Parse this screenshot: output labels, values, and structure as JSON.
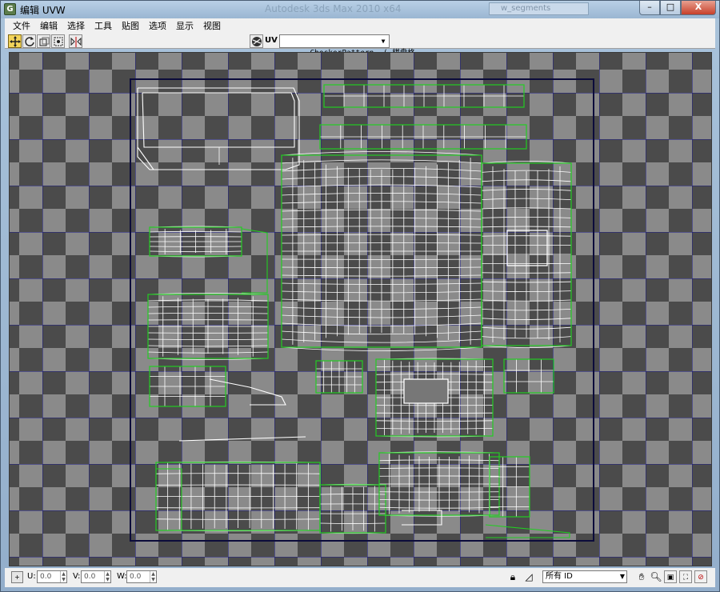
{
  "window": {
    "title": "编辑 UVW",
    "app_icon": "G",
    "background_title": "Autodesk 3ds Max  2010 x64",
    "background_search": "w_segments"
  },
  "window_controls": {
    "minimize": "–",
    "maximize": "□",
    "close": "X"
  },
  "menu": [
    "文件",
    "编辑",
    "选择",
    "工具",
    "贴图",
    "选项",
    "显示",
    "视图"
  ],
  "toolbar": {
    "tools": [
      "move-tool",
      "rotate-tool",
      "scale-tool",
      "freeform-tool",
      "mirror-tool"
    ],
    "uv_label": "UV",
    "texture_selected": "CheckerPattern  ( 棋盘格"
  },
  "viewport": {
    "background": "checker",
    "checker_light": "#8a8a8a",
    "checker_dark": "#4a4a4a",
    "grid_color": "#1a1a8c",
    "seam_color": "#22cc22",
    "edge_color": "#ffffff"
  },
  "statusbar": {
    "u_label": "U:",
    "u_value": "0.0",
    "v_label": "V:",
    "v_value": "0.0",
    "w_label": "W:",
    "w_value": "0.0",
    "id_filter": "所有 ID",
    "icons": [
      "lock-icon",
      "paint-icon",
      "pan-icon",
      "zoom-icon",
      "zoom-region-icon",
      "zoom-extents-icon",
      "texture-toggle-icon"
    ]
  }
}
